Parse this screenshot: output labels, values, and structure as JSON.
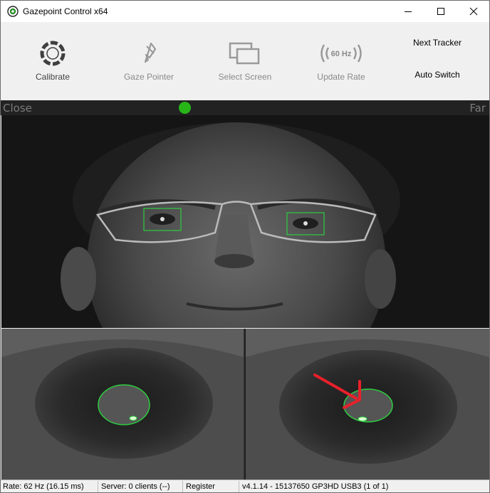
{
  "window": {
    "title": "Gazepoint Control x64"
  },
  "toolbar": {
    "calibrate_label": "Calibrate",
    "gaze_pointer_label": "Gaze Pointer",
    "select_screen_label": "Select Screen",
    "update_rate_label": "Update Rate",
    "update_rate_icon_text": "60 Hz",
    "next_tracker_label": "Next Tracker",
    "auto_switch_label": "Auto Switch"
  },
  "distance": {
    "close_label": "Close",
    "far_label": "Far",
    "indicator_color": "#27b517"
  },
  "status": {
    "rate": "Rate: 62 Hz (16.15 ms)",
    "server": "Server: 0 clients (--)",
    "register": "Register",
    "version": "v4.1.14 - 15137650 GP3HD USB3 (1 of 1)"
  },
  "colors": {
    "tracking_box": "#2ecc40",
    "pupil_ellipse": "#2ecc40",
    "annotation_arrow": "#e8202a"
  }
}
